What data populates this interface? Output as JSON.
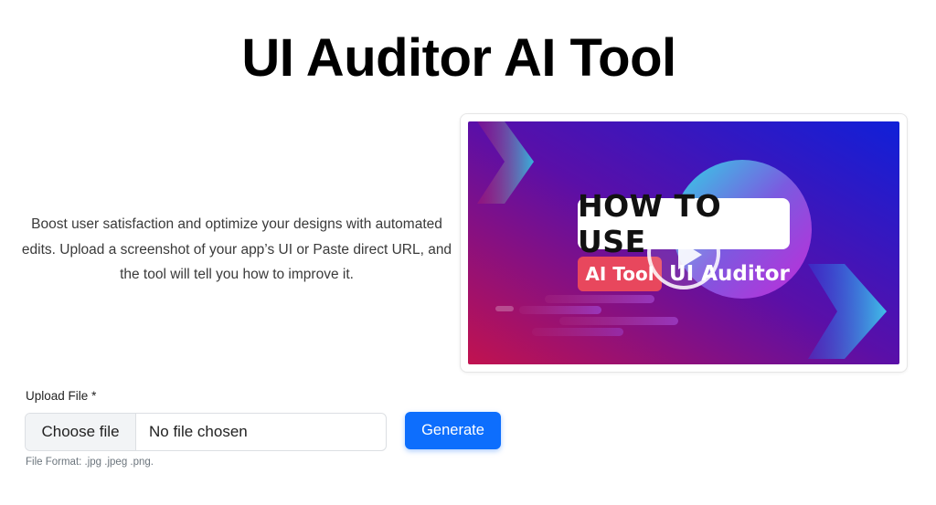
{
  "page": {
    "title": "UI Auditor AI Tool",
    "description": "Boost user satisfaction and optimize your designs with automated edits. Upload a screenshot of your app’s UI or Paste direct URL, and the tool will tell you how to improve it."
  },
  "video": {
    "banner_text": "HOW TO USE",
    "tag_ai": "AI Tool",
    "tag_auditor": "UI Auditor",
    "play_icon": "play-icon",
    "colors": {
      "bg_left": "#c1124f",
      "bg_mid": "#5a0fa8",
      "bg_right": "#1020d8",
      "circle_start": "#2fd6e6",
      "circle_end": "#c22ad8",
      "tag_ai": "#e8475d"
    }
  },
  "upload": {
    "label": "Upload File",
    "required_mark": "*",
    "choose_button": "Choose file",
    "status": "No file chosen",
    "format_hint": "File Format: .jpg .jpeg .png."
  },
  "actions": {
    "generate_label": "Generate",
    "accent": "#0d6efd"
  }
}
